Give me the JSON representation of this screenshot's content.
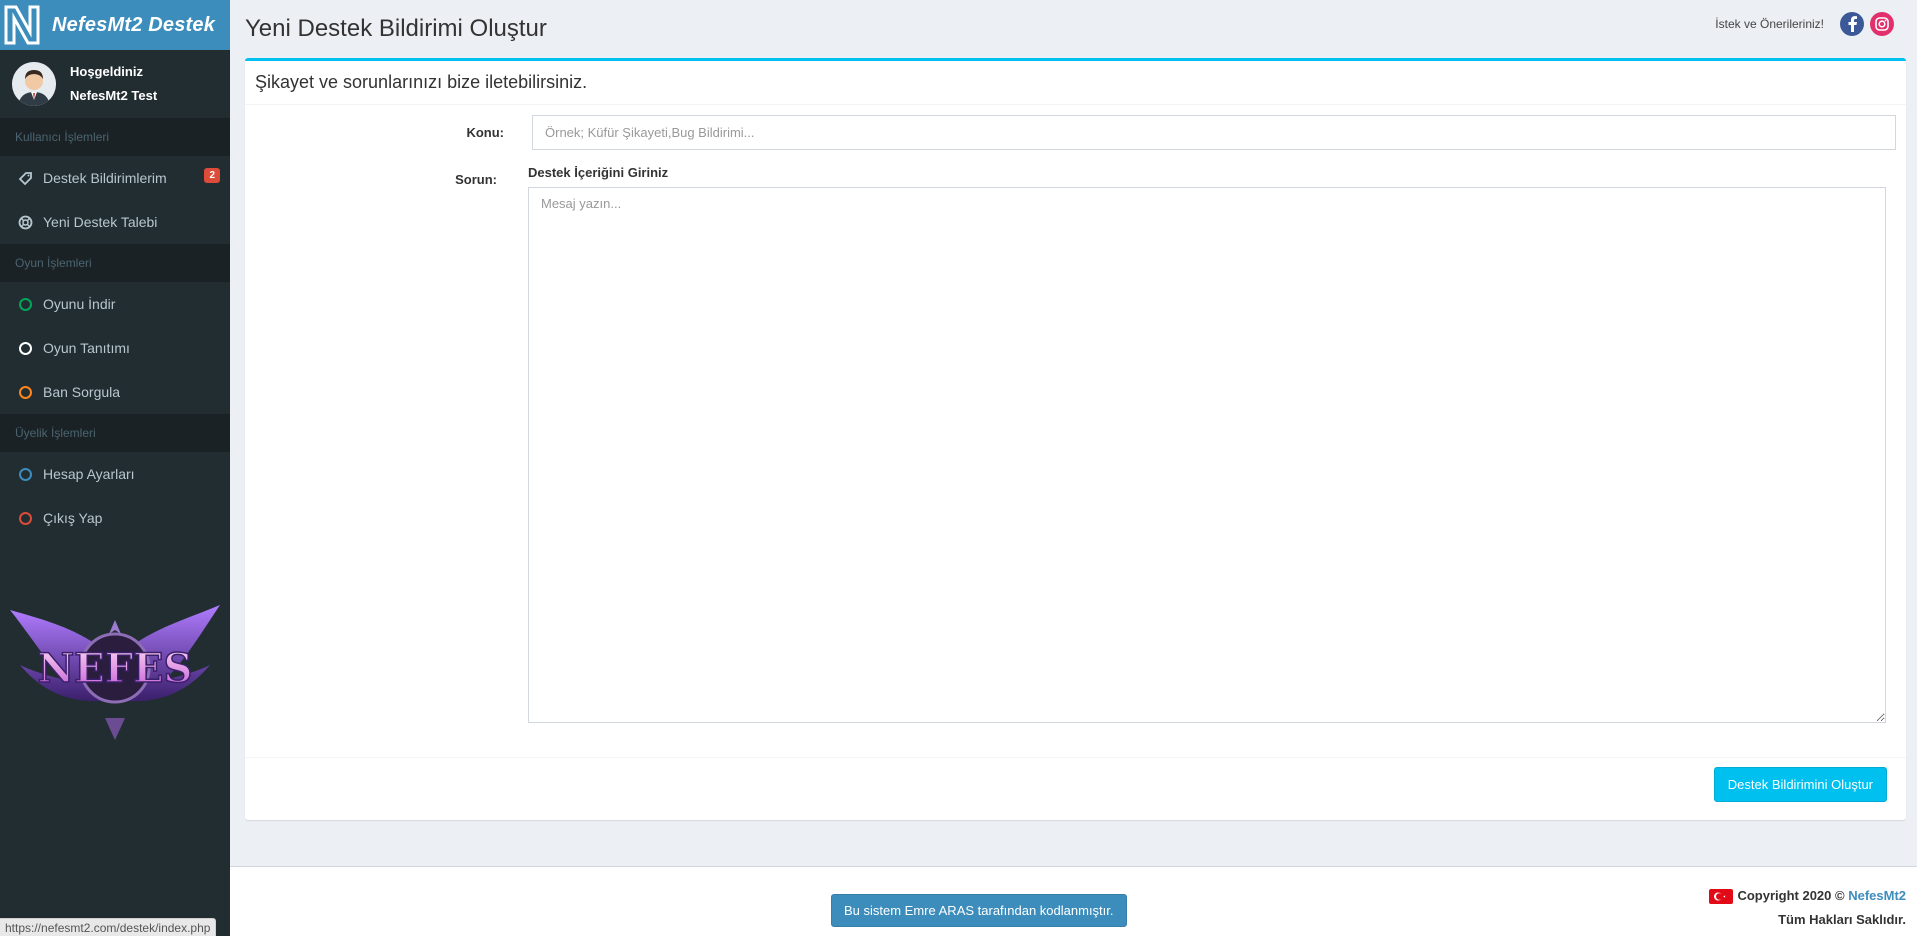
{
  "brand": {
    "name": "NefesMt2 Destek"
  },
  "user": {
    "greeting": "Hoşgeldiniz",
    "name": "NefesMt2 Test"
  },
  "sidebar": {
    "sections": [
      {
        "header": "Kullanıcı İşlemleri"
      },
      {
        "header": "Oyun İşlemleri"
      },
      {
        "header": "Üyelik İşlemleri"
      }
    ],
    "items": [
      {
        "label": "Destek Bildirimlerim",
        "icon": "ticket-icon",
        "badge": "2"
      },
      {
        "label": "Yeni Destek Talebi",
        "icon": "life-ring-icon"
      },
      {
        "label": "Oyunu İndir",
        "icon": "circle-green-icon",
        "color": "#00a65a"
      },
      {
        "label": "Oyun Tanıtımı",
        "icon": "circle-white-icon",
        "color": "#ffffff"
      },
      {
        "label": "Ban Sorgula",
        "icon": "circle-orange-icon",
        "color": "#ff851b"
      },
      {
        "label": "Hesap Ayarları",
        "icon": "circle-blue-icon",
        "color": "#3c8dbc"
      },
      {
        "label": "Çıkış Yap",
        "icon": "circle-red-icon",
        "color": "#dd4b39"
      }
    ],
    "art_text": "NEFES"
  },
  "header": {
    "title": "Yeni Destek Bildirimi Oluştur",
    "hint": "İstek ve Önerileriniz!",
    "social": [
      "facebook-icon",
      "instagram-icon"
    ]
  },
  "form": {
    "box_title": "Şikayet ve sorunlarınızı bize iletebilirsiniz.",
    "subject_label": "Konu:",
    "subject_placeholder": "Örnek; Küfür Şikayeti,Bug Bildirimi...",
    "subject_value": "",
    "problem_label": "Sorun:",
    "editor_label": "Destek İçeriğini Giriniz",
    "message_placeholder": "Mesaj yazın...",
    "message_value": "",
    "submit_label": "Destek Bildirimini Oluştur"
  },
  "footer": {
    "credit": "Bu sistem Emre ARAS tarafından kodlanmıştır.",
    "copyright_prefix": "Copyright 2020 ©",
    "copyright_brand": "NefesMt2",
    "rights": "Tüm Hakları Saklıdır."
  },
  "status_bar": {
    "url": "https://nefesmt2.com/destek/index.php"
  },
  "colors": {
    "brand": "#3c8dbc",
    "sidebar": "#222d32",
    "accent": "#00c0ef",
    "badge": "#dd4b39"
  }
}
